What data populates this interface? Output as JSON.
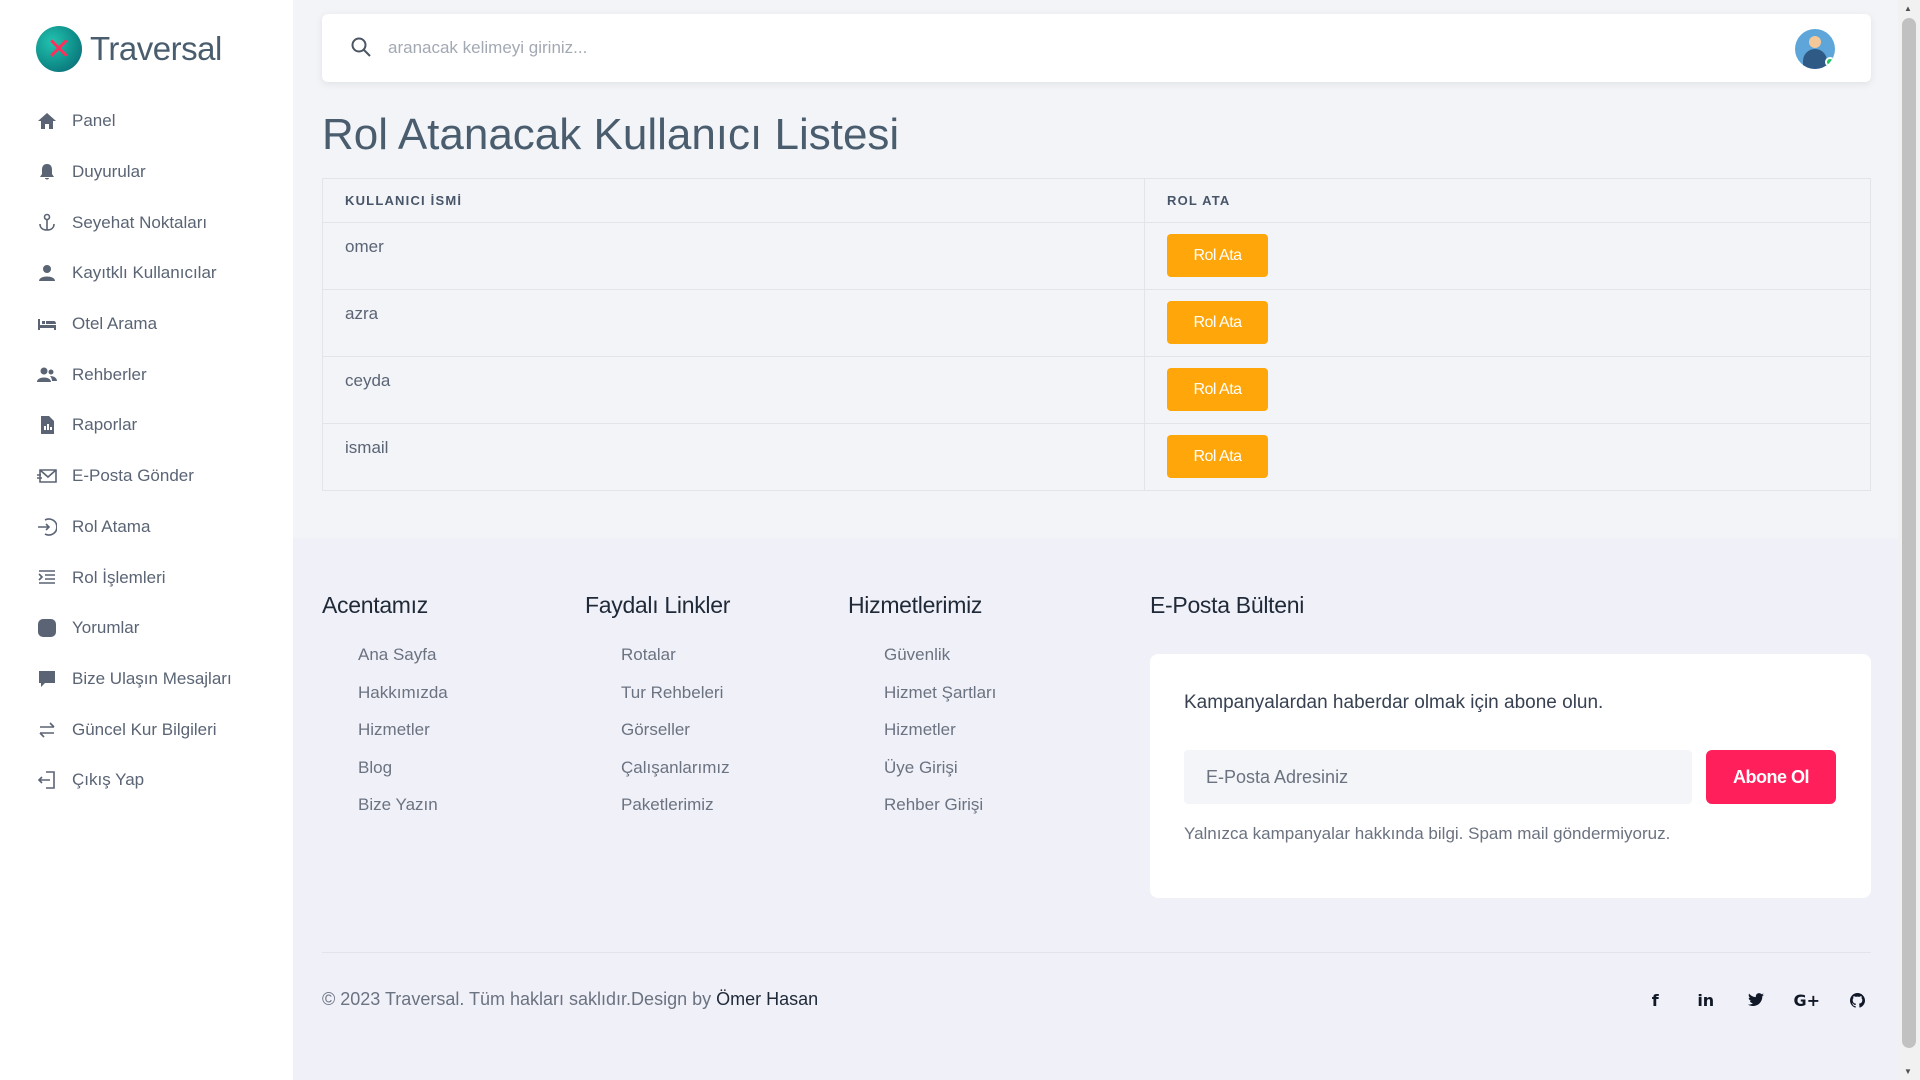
{
  "app": {
    "name": "Traversal"
  },
  "sidebar": {
    "items": [
      {
        "label": "Panel",
        "icon": "home-icon"
      },
      {
        "label": "Duyurular",
        "icon": "bell-icon"
      },
      {
        "label": "Seyehat Noktaları",
        "icon": "anchor-icon"
      },
      {
        "label": "Kayıtklı Kullanıcılar",
        "icon": "user-icon"
      },
      {
        "label": "Otel Arama",
        "icon": "bed-icon"
      },
      {
        "label": "Rehberler",
        "icon": "users-icon"
      },
      {
        "label": "Raporlar",
        "icon": "report-icon"
      },
      {
        "label": "E-Posta Gönder",
        "icon": "mail-send-icon"
      },
      {
        "label": "Rol Atama",
        "icon": "sign-in-icon"
      },
      {
        "label": "Rol İşlemleri",
        "icon": "list-indent-icon"
      },
      {
        "label": "Yorumlar",
        "icon": "comment-square-icon"
      },
      {
        "label": "Bize Ulaşın Mesajları",
        "icon": "message-icon"
      },
      {
        "label": "Güncel Kur Bilgileri",
        "icon": "exchange-icon"
      },
      {
        "label": "Çıkış Yap",
        "icon": "logout-icon"
      }
    ]
  },
  "topbar": {
    "search_placeholder": "aranacak kelimeyi giriniz..."
  },
  "page": {
    "title": "Rol Atanacak Kullanıcı Listesi"
  },
  "table": {
    "headers": [
      "KULLANICI İSMİ",
      "ROL ATA"
    ],
    "rows": [
      {
        "name": "omer",
        "action": "Rol Ata"
      },
      {
        "name": "azra",
        "action": "Rol Ata"
      },
      {
        "name": "ceyda",
        "action": "Rol Ata"
      },
      {
        "name": "ismail",
        "action": "Rol Ata"
      }
    ]
  },
  "footer": {
    "columns": [
      {
        "title": "Acentamız",
        "links": [
          "Ana Sayfa",
          "Hakkımızda",
          "Hizmetler",
          "Blog",
          "Bize Yazın"
        ]
      },
      {
        "title": "Faydalı Linkler",
        "links": [
          "Rotalar",
          "Tur Rehbeleri",
          "Görseller",
          "Çalışanlarımız",
          "Paketlerimiz"
        ]
      },
      {
        "title": "Hizmetlerimiz",
        "links": [
          "Güvenlik",
          "Hizmet Şartları",
          "Hizmetler",
          "Üye Girişi",
          "Rehber Girişi"
        ]
      }
    ],
    "newsletter": {
      "title": "E-Posta Bülteni",
      "text": "Kampanyalardan haberdar olmak için abone olun.",
      "placeholder": "E-Posta Adresiniz",
      "button": "Abone Ol",
      "note": "Yalnızca kampanyalar hakkında bilgi. Spam mail göndermiyoruz."
    },
    "copyright": "© 2023 Traversal. Tüm hakları saklıdır.Design by ",
    "author": "Ömer Hasan",
    "social": [
      "f",
      "in",
      "🐦",
      "G+",
      "⌥"
    ]
  },
  "colors": {
    "accent": "#ffa60a",
    "subscribe": "#ff1f5a",
    "text": "#4a5d6e"
  }
}
